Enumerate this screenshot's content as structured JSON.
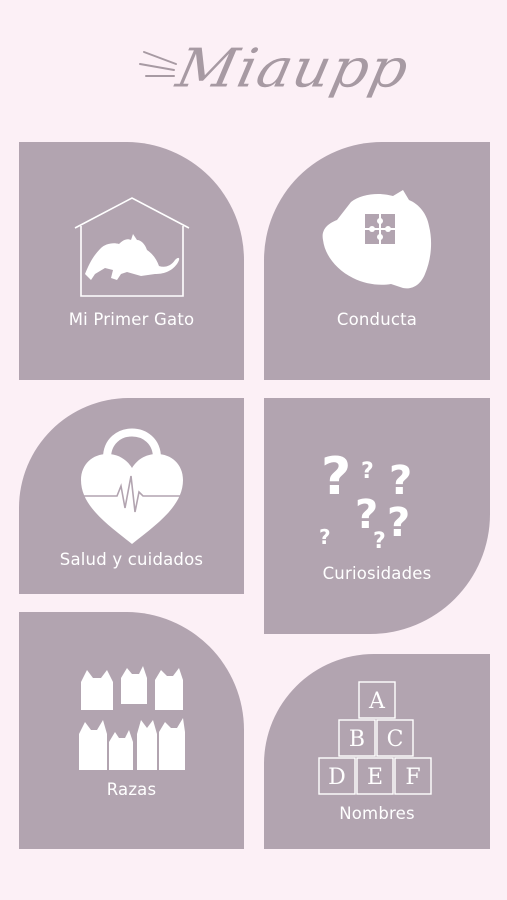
{
  "app": {
    "logo_text": "Miaupp"
  },
  "colors": {
    "background": "#fcf0f6",
    "tile": "#b2a4b0",
    "text": "#ffffff",
    "logo": "#a79aa3"
  },
  "tiles": [
    {
      "label": "Mi Primer Gato",
      "icon": "house-cat-icon"
    },
    {
      "label": "Conducta",
      "icon": "cat-head-puzzle-icon"
    },
    {
      "label": "Salud y cuidados",
      "icon": "heart-lock-heartbeat-icon"
    },
    {
      "label": "Curiosidades",
      "icon": "question-marks-icon"
    },
    {
      "label": "Razas",
      "icon": "cats-silhouettes-icon"
    },
    {
      "label": "Nombres",
      "icon": "letter-blocks-icon"
    }
  ],
  "blocks": [
    "A",
    "B",
    "C",
    "D",
    "E",
    "F"
  ]
}
